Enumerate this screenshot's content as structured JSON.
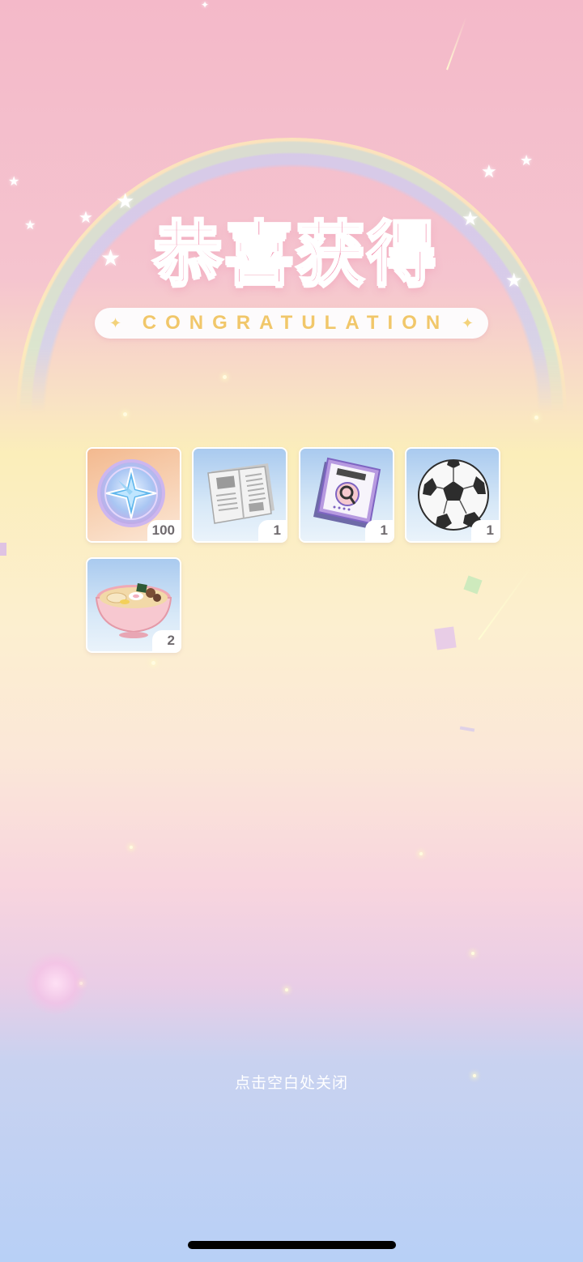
{
  "header": {
    "title": "恭喜获得",
    "subtitle": "CONGRATULATION",
    "subtitle_star": "✦"
  },
  "rewards": [
    {
      "name": "star-coin",
      "quantity": "100",
      "icon": "compass-star-coin-icon"
    },
    {
      "name": "newspaper",
      "quantity": "1",
      "icon": "newspaper-icon"
    },
    {
      "name": "magazine",
      "quantity": "1",
      "icon": "magazine-icon"
    },
    {
      "name": "soccer-ball",
      "quantity": "1",
      "icon": "soccer-ball-icon"
    },
    {
      "name": "ramen-bowl",
      "quantity": "2",
      "icon": "ramen-bowl-icon"
    }
  ],
  "footer": {
    "close_hint": "点击空白处关闭"
  },
  "colors": {
    "title_pink": "#f28fae",
    "subtitle_gold": "#f1c76a",
    "background_top": "#f4b9c9",
    "background_bottom": "#b8d0f6"
  }
}
